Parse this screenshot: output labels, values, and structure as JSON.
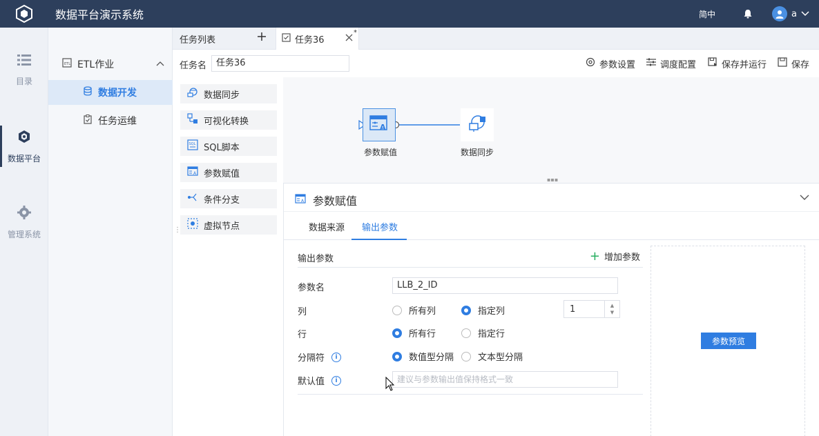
{
  "app": {
    "title": "数据平台演示系统"
  },
  "header": {
    "language": "简中",
    "user_name": "a"
  },
  "leftnav": {
    "items": [
      {
        "label": "目录",
        "icon": "list-icon"
      },
      {
        "label": "数据平台",
        "icon": "cube-icon"
      },
      {
        "label": "管理系统",
        "icon": "gear-icon"
      }
    ]
  },
  "sidebar": {
    "group_label": "ETL作业",
    "items": [
      {
        "label": "数据开发"
      },
      {
        "label": "任务运维"
      }
    ]
  },
  "tabs": {
    "list_label": "任务列表",
    "active_label": "任务36",
    "modified_mark": "*"
  },
  "toolbar": {
    "task_name_label": "任务名",
    "task_name_value": "任务36",
    "param_settings": "参数设置",
    "schedule_config": "调度配置",
    "save_and_run": "保存并运行",
    "save": "保存"
  },
  "palette": {
    "items": [
      {
        "label": "数据同步"
      },
      {
        "label": "可视化转换"
      },
      {
        "label": "SQL脚本"
      },
      {
        "label": "参数赋值"
      },
      {
        "label": "条件分支"
      },
      {
        "label": "虚拟节点"
      }
    ]
  },
  "canvas": {
    "nodes": [
      {
        "label": "参数赋值"
      },
      {
        "label": "数据同步"
      }
    ]
  },
  "panel": {
    "title": "参数赋值",
    "tabs": [
      {
        "label": "数据来源"
      },
      {
        "label": "输出参数"
      }
    ],
    "section_title": "输出参数",
    "add_param": "增加参数",
    "fields": {
      "param_name_label": "参数名",
      "param_name_value": "LLB_2_ID",
      "column_label": "列",
      "column_all": "所有列",
      "column_specified": "指定列",
      "column_index": "1",
      "row_label": "行",
      "row_all": "所有行",
      "row_specified": "指定行",
      "separator_label": "分隔符",
      "separator_numeric": "数值型分隔",
      "separator_text": "文本型分隔",
      "default_label": "默认值",
      "default_placeholder": "建议与参数输出值保持格式一致"
    },
    "preview_button": "参数预览"
  },
  "colors": {
    "header_bg": "#2d3f5c",
    "accent": "#2f7de1",
    "add_green": "#27ae60"
  }
}
